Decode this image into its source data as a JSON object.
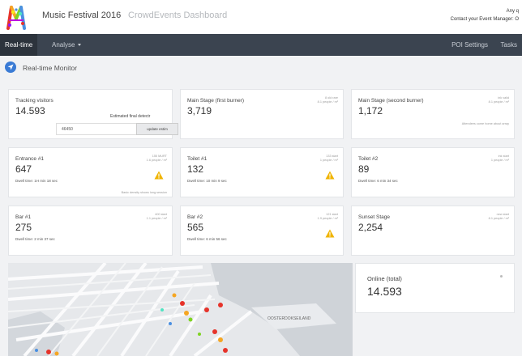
{
  "header": {
    "app_title": "Music Festival 2016",
    "subtitle": "CrowdEvents Dashboard",
    "user_line1": "Any q",
    "user_line2": "Contact your Event Manager: O"
  },
  "nav": {
    "items": [
      {
        "label": "Real-time",
        "active": true
      },
      {
        "label": "Analyse",
        "active": false
      }
    ],
    "right": [
      "POI Settings",
      "Tasks"
    ]
  },
  "section": {
    "title": "Real-time Monitor"
  },
  "tracking": {
    "title": "Tracking visitors",
    "value": "14.593",
    "estimate_label": "Estimated final detectr",
    "estimate_value": "46450",
    "update_button": "update estim"
  },
  "cards": [
    {
      "id": "main-stage-first",
      "title": "Main Stage (first burner)",
      "value": "3,719",
      "meta1": "8 old rare",
      "meta2": "8.1 people / m²",
      "note": "",
      "warning": false
    },
    {
      "id": "main-stage-second",
      "title": "Main Stage (second burner)",
      "value": "1,172",
      "meta1": "ink valid",
      "meta2": "8.1 people / m²",
      "note": "Attendees come home about array",
      "warning": false
    },
    {
      "id": "entrance-1",
      "title": "Entrance #1",
      "value": "647",
      "meta1": "155 MURT",
      "meta2": "1.6 people / m²",
      "dwell": "Dwell time: 1H min 18 sec",
      "note": "Basic density shows long session",
      "warning": true
    },
    {
      "id": "toilet-1",
      "title": "Toilet #1",
      "value": "132",
      "meta1": "133 start",
      "meta2": "1 people / m²",
      "dwell": "Dwell time: 10 min 9 sec",
      "note": "",
      "warning": true
    },
    {
      "id": "toilet-2",
      "title": "Toilet #2",
      "value": "89",
      "meta1": "ink start",
      "meta2": "1 people / m²",
      "dwell": "Dwell time: 6 min 34 sec",
      "note": "",
      "warning": false
    },
    {
      "id": "bar-1",
      "title": "Bar #1",
      "value": "275",
      "meta1": "400 start",
      "meta2": "1.1 people / m²",
      "dwell": "Dwell time: 2 min 37 sec",
      "note": "",
      "warning": false
    },
    {
      "id": "bar-2",
      "title": "Bar #2",
      "value": "565",
      "meta1": "121 start",
      "meta2": "1.9 people / m²",
      "dwell": "Dwell time: 6 min 56 sec",
      "note": "",
      "warning": true
    },
    {
      "id": "sunset-stage",
      "title": "Sunset Stage",
      "value": "2,254",
      "meta1": "new start",
      "meta2": "8.1 people / m²",
      "note": "",
      "warning": false
    }
  ],
  "map": {
    "label": "OOSTERDOKSEILAND"
  },
  "online": {
    "title": "Online (total)",
    "value": "14.593"
  },
  "colors": {
    "nav_bg": "#3b4450",
    "nav_active": "#2c333c",
    "accent": "#3a7bd5",
    "warning": "#f0b400"
  },
  "icons": {
    "monitor": "location-arrow-icon",
    "warning": "warning-triangle-icon"
  }
}
